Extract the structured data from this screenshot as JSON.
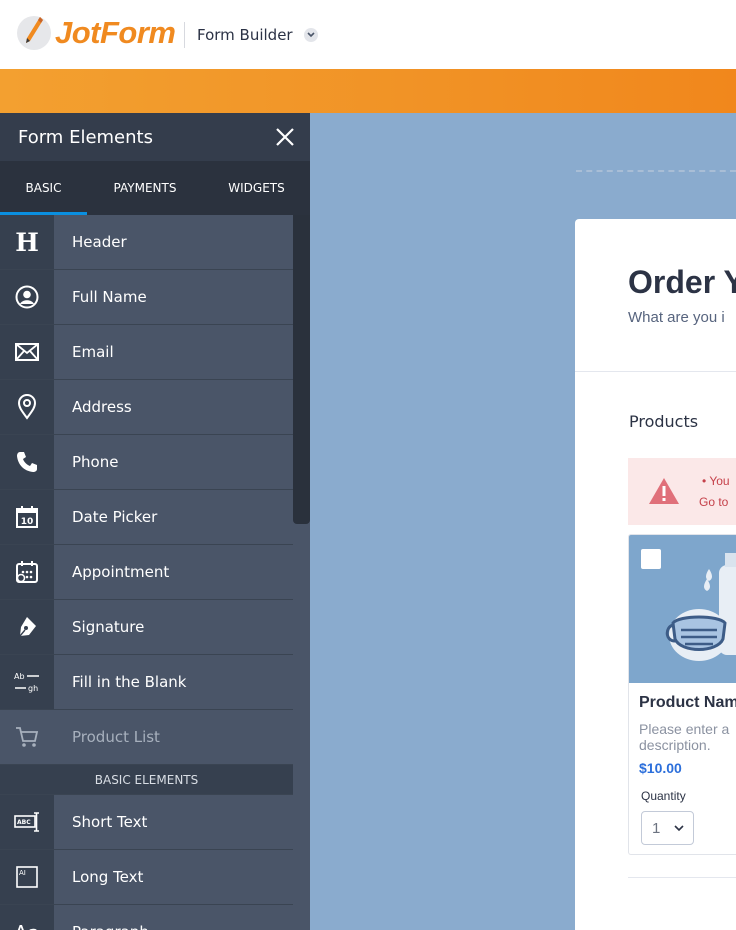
{
  "header": {
    "brand": "JotForm",
    "mode_label": "Form Builder"
  },
  "panel": {
    "title": "Form Elements",
    "tabs": [
      {
        "label": "BASIC"
      },
      {
        "label": "PAYMENTS"
      },
      {
        "label": "WIDGETS"
      }
    ],
    "active_tab": "BASIC",
    "items": [
      {
        "label": "Header",
        "icon": "header-icon"
      },
      {
        "label": "Full Name",
        "icon": "user-icon"
      },
      {
        "label": "Email",
        "icon": "envelope-icon"
      },
      {
        "label": "Address",
        "icon": "map-pin-icon"
      },
      {
        "label": "Phone",
        "icon": "phone-icon"
      },
      {
        "label": "Date Picker",
        "icon": "calendar-icon"
      },
      {
        "label": "Appointment",
        "icon": "appointment-icon"
      },
      {
        "label": "Signature",
        "icon": "pen-icon"
      },
      {
        "label": "Fill in the Blank",
        "icon": "fill-blank-icon"
      },
      {
        "label": "Product List",
        "icon": "cart-icon"
      }
    ],
    "section_label": "BASIC ELEMENTS",
    "items2": [
      {
        "label": "Short Text",
        "icon": "short-text-icon"
      },
      {
        "label": "Long Text",
        "icon": "long-text-icon"
      },
      {
        "label": "Paragraph",
        "icon": "paragraph-icon"
      }
    ]
  },
  "form": {
    "title": "Order Y",
    "subtitle": "What are you i",
    "products_label": "Products",
    "error_line1": "You",
    "error_line2": "Go to",
    "product": {
      "name": "Product Nam",
      "desc_line1": "Please enter a",
      "desc_line2": "description.",
      "price": "$10.00",
      "quantity_label": "Quantity",
      "quantity_value": "1"
    }
  },
  "colors": {
    "brand_orange": "#f19326",
    "panel_bg": "#4a5568",
    "canvas_bg": "#8aabce",
    "tab_active": "#0a8fe0"
  }
}
